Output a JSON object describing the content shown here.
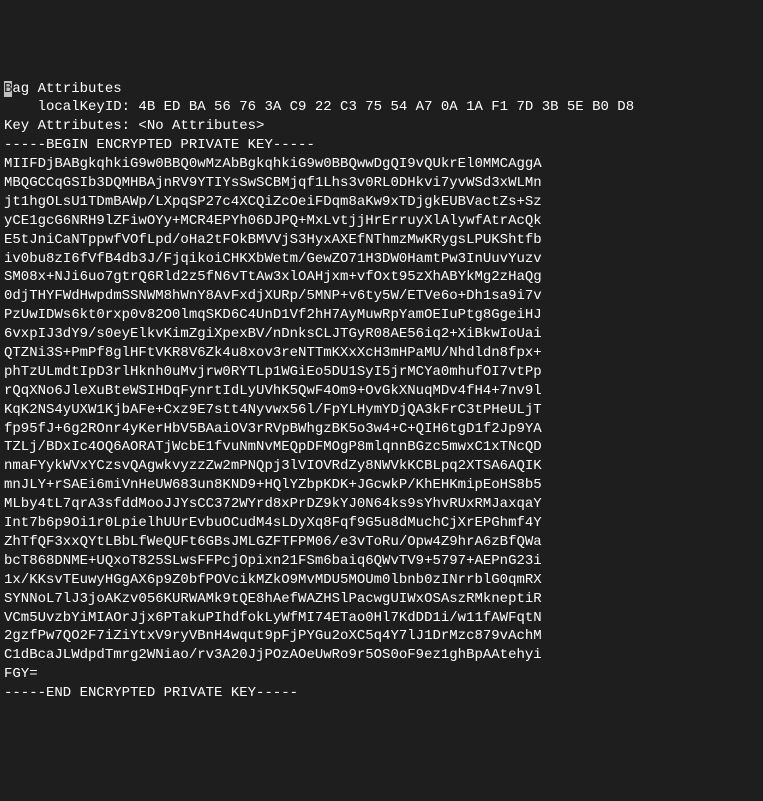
{
  "lines": [
    {
      "prefix_highlight": "B",
      "text": "ag Attributes"
    },
    {
      "text": "    localKeyID: 4B ED BA 56 76 3A C9 22 C3 75 54 A7 0A 1A F1 7D 3B 5E B0 D8 "
    },
    {
      "text": "Key Attributes: <No Attributes>"
    },
    {
      "text": "-----BEGIN ENCRYPTED PRIVATE KEY-----"
    },
    {
      "text": "MIIFDjBABgkqhkiG9w0BBQ0wMzAbBgkqhkiG9w0BBQwwDgQI9vQUkrEl0MMCAggA"
    },
    {
      "text": "MBQGCCqGSIb3DQMHBAjnRV9YTIYsSwSCBMjqf1Lhs3v0RL0DHkvi7yvWSd3xWLMn"
    },
    {
      "text": "jt1hgOLsU1TDmBAWp/LXpqSP27c4XCQiZcOeiFDqm8aKw9xTDjgkEUBVactZs+Sz"
    },
    {
      "text": "yCE1gcG6NRH9lZFiwOYy+MCR4EPYh06DJPQ+MxLvtjjHrErruyXlAlywfAtrAcQk"
    },
    {
      "text": "E5tJniCaNTppwfVOfLpd/oHa2tFOkBMVVjS3HyxAXEfNThmzMwKRygsLPUKShtfb"
    },
    {
      "text": "iv0bu8zI6fVfB4db3J/FjqikoiCHKXbWetm/GewZO71H3DW0HamtPw3InUuvYuzv"
    },
    {
      "text": "SM08x+NJi6uo7gtrQ6Rld2z5fN6vTtAw3xlOAHjxm+vfOxt95zXhABYkMg2zHaQg"
    },
    {
      "text": "0djTHYFWdHwpdmSSNWM8hWnY8AvFxdjXURp/5MNP+v6ty5W/ETVe6o+Dh1sa9i7v"
    },
    {
      "text": "PzUwIDWs6kt0rxp0v82O0lmqSKD6C4UnD1Vf2hH7AyMuwRpYamOEIuPtg8GgeiHJ"
    },
    {
      "text": "6vxpIJ3dY9/s0eyElkvKimZgiXpexBV/nDnksCLJTGyR08AE56iq2+XiBkwIoUai"
    },
    {
      "text": "QTZNi3S+PmPf8glHFtVKR8V6Zk4u8xov3reNTTmKXxXcH3mHPaMU/Nhdldn8fpx+"
    },
    {
      "text": "phTzULmdtIpD3rlHknh0uMvjrw0RYTLp1WGiEo5DU1SyI5jrMCYa0mhufOI7vtPp"
    },
    {
      "text": "rQqXNo6JleXuBteWSIHDqFynrtIdLyUVhK5QwF4Om9+OvGkXNuqMDv4fH4+7nv9l"
    },
    {
      "text": "KqK2NS4yUXW1KjbAFe+Cxz9E7stt4Nyvwx56l/FpYLHymYDjQA3kFrC3tPHeULjT"
    },
    {
      "text": "fp95fJ+6g2ROnr4yKerHbV5BAaiOV3rRVpBWhgzBK5o3w4+C+QIH6tgD1f2Jp9YA"
    },
    {
      "text": "TZLj/BDxIc4OQ6AORATjWcbE1fvuNmNvMEQpDFMOgP8mlqnnBGzc5mwxC1xTNcQD"
    },
    {
      "text": "nmaFYykWVxYCzsvQAgwkvyzzZw2mPNQpj3lVIOVRdZy8NWVkKCBLpq2XTSA6AQIK"
    },
    {
      "text": "mnJLY+rSAEi6miVnHeUW683un8KND9+HQlYZbpKDK+JGcwkP/KhEHKmipEoHS8b5"
    },
    {
      "text": "MLby4tL7qrA3sfddMooJJYsCC372WYrd8xPrDZ9kYJ0N64ks9sYhvRUxRMJaxqaY"
    },
    {
      "text": "Int7b6p9Oi1r0LpielhUUrEvbuOCudM4sLDyXq8Fqf9G5u8dMuchCjXrEPGhmf4Y"
    },
    {
      "text": "ZhTfQF3xxQYtLBbLfWeQUFt6GBsJMLGZFTFPM06/e3vToRu/Opw4Z9hrA6zBfQWa"
    },
    {
      "text": "bcT868DNME+UQxoT825SLwsFFPcjOpixn21FSm6baiq6QWvTV9+5797+AEPnG23i"
    },
    {
      "text": "1x/KKsvTEuwyHGgAX6p9Z0bfPOVcikMZkO9MvMDU5MOUm0lbnb0zINrrblG0qmRX"
    },
    {
      "text": "SYNNoL7lJ3joAKzv056KURWAMk9tQE8hAefWAZHSlPacwgUIWxOSAszRMkneptiR"
    },
    {
      "text": "VCm5UvzbYiMIAOrJjx6PTakuPIhdfokLyWfMI74ETao0Hl7KdDD1i/w11fAWFqtN"
    },
    {
      "text": "2gzfPw7QO2F7iZiYtxV9ryVBnH4wqut9pFjPYGu2oXC5q4Y7lJ1DrMzc879vAchM"
    },
    {
      "text": "C1dBcaJLWdpdTmrg2WNiao/rv3A20JjPOzAOeUwRo9r5OS0oF9ez1ghBpAAtehyi"
    },
    {
      "text": "FGY="
    },
    {
      "text": "-----END ENCRYPTED PRIVATE KEY-----"
    }
  ]
}
